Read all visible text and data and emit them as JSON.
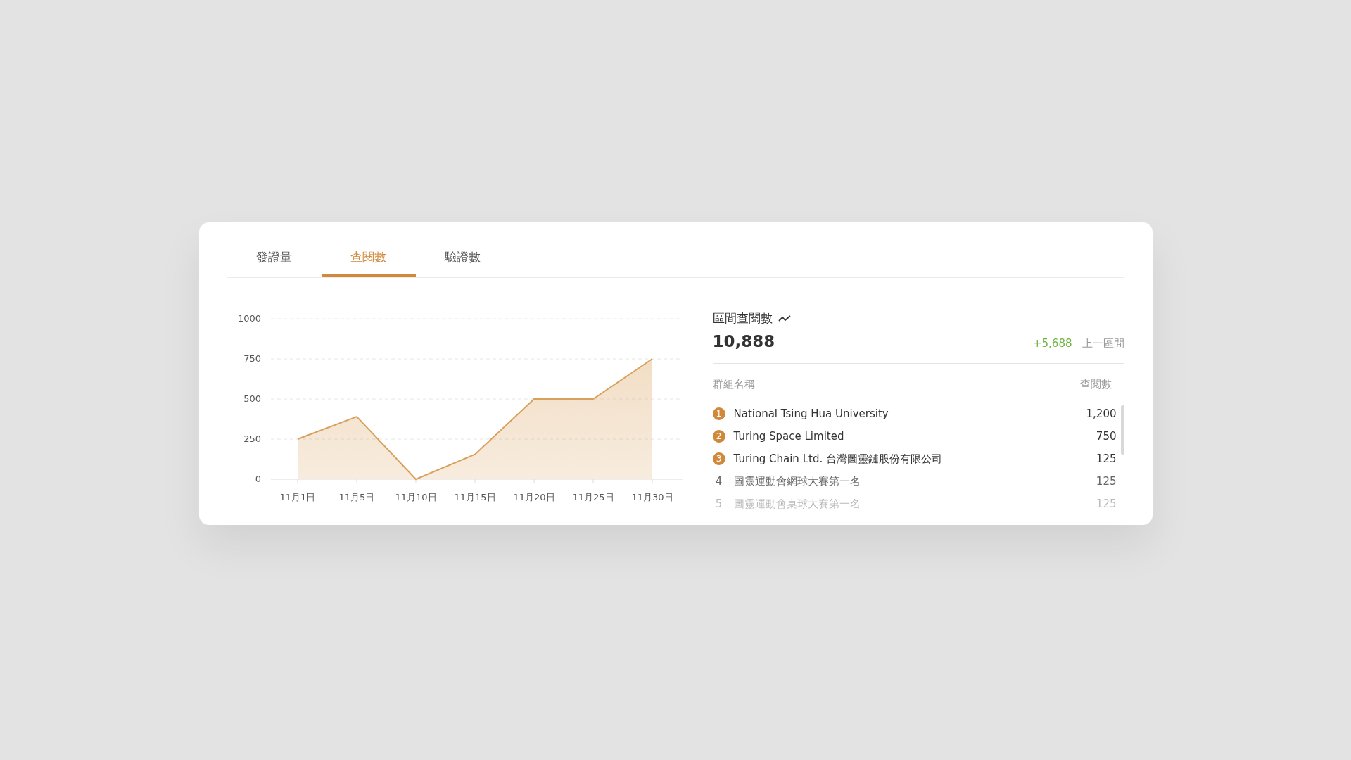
{
  "tabs": [
    {
      "label": "發證量",
      "selected": false
    },
    {
      "label": "查閱數",
      "selected": true
    },
    {
      "label": "驗證數",
      "selected": false
    }
  ],
  "chart_data": {
    "type": "area",
    "categories": [
      "11月1日",
      "11月5日",
      "11月10日",
      "11月15日",
      "11月20日",
      "11月25日",
      "11月30日"
    ],
    "series": [
      {
        "color": "#d9a05b",
        "values": [
          250,
          390,
          0,
          155,
          500,
          500,
          750
        ]
      }
    ],
    "grid": true,
    "ylim": [
      0,
      1000
    ],
    "yticks": [
      0,
      250,
      500,
      750,
      1000
    ]
  },
  "summary": {
    "title": "區間查閱數",
    "total": "10,888",
    "change": "+5,688",
    "compare_label": "上一區間"
  },
  "ranking": {
    "columns": [
      "群組名稱",
      "查閱數"
    ],
    "rows": [
      {
        "rank": "1",
        "kind": "medal",
        "name": "National Tsing Hua University",
        "count": "1,200"
      },
      {
        "rank": "2",
        "kind": "medal",
        "name": "Turing Space Limited",
        "count": "750"
      },
      {
        "rank": "3",
        "kind": "medal",
        "name": "Turing Chain Ltd. 台灣圖靈鏈股份有限公司",
        "count": "125"
      },
      {
        "rank": "4",
        "kind": "plain",
        "name": "圖靈運動會網球大賽第一名",
        "count": "125"
      },
      {
        "rank": "5",
        "kind": "plain",
        "name": "圖靈運動會桌球大賽第一名",
        "count": "125"
      }
    ]
  }
}
